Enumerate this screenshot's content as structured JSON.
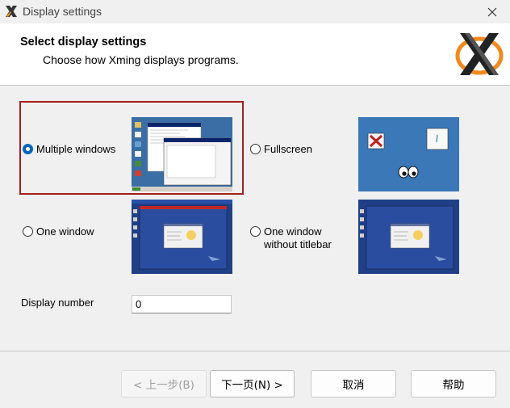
{
  "window": {
    "title": "Display settings",
    "close_icon": "close-icon"
  },
  "header": {
    "title": "Select display settings",
    "subtitle": "Choose how Xming displays programs."
  },
  "options": {
    "multiple_windows": {
      "label": "Multiple windows",
      "checked": true
    },
    "fullscreen": {
      "label": "Fullscreen",
      "checked": false
    },
    "one_window": {
      "label": "One window",
      "checked": false
    },
    "one_window_no_titlebar": {
      "line1": "One window",
      "line2": "without titlebar",
      "checked": false
    }
  },
  "display_number": {
    "label": "Display number",
    "value": "0"
  },
  "buttons": {
    "back": "< 上一步(B)",
    "next": "下一页(N) >",
    "cancel": "取消",
    "help": "帮助"
  },
  "colors": {
    "accent": "#0067c0",
    "highlight": "#a51d1d",
    "desktop_blue": "#3a6ea5"
  }
}
